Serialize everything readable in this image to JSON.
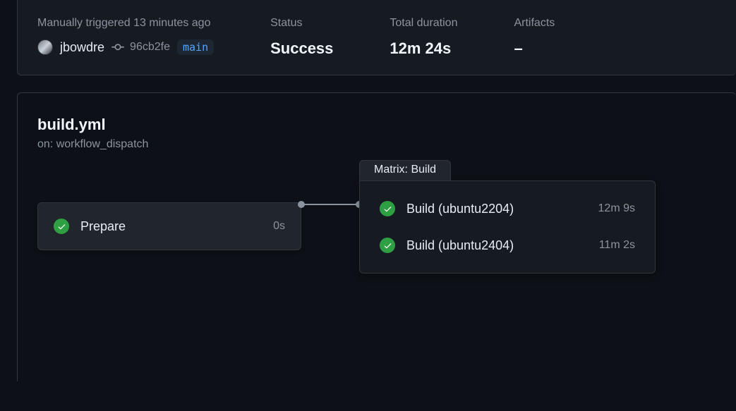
{
  "summary": {
    "trigger_text": "Manually triggered 13 minutes ago",
    "username": "jbowdre",
    "sha": "96cb2fe",
    "branch": "main",
    "status_label": "Status",
    "status_value": "Success",
    "duration_label": "Total duration",
    "duration_value": "12m 24s",
    "artifacts_label": "Artifacts",
    "artifacts_value": "–"
  },
  "workflow": {
    "title": "build.yml",
    "subtitle": "on: workflow_dispatch",
    "prepare": {
      "name": "Prepare",
      "time": "0s"
    },
    "matrix": {
      "label": "Matrix: Build",
      "jobs": [
        {
          "name": "Build (ubuntu2204)",
          "time": "12m 9s"
        },
        {
          "name": "Build (ubuntu2404)",
          "time": "11m 2s"
        }
      ]
    }
  }
}
